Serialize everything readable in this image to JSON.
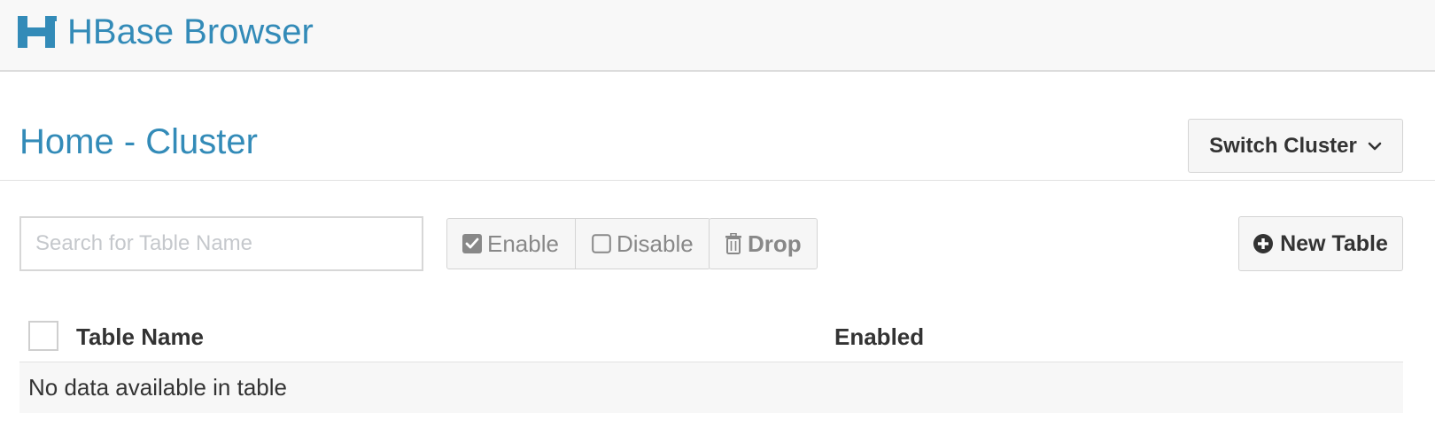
{
  "header": {
    "app_title": "HBase Browser",
    "logo_icon": "hbase-logo-icon",
    "brand_color": "#338bb8"
  },
  "page": {
    "title": "Home - Cluster",
    "switch_cluster_label": "Switch Cluster",
    "switch_cluster_icon": "chevron-down-icon"
  },
  "toolbar": {
    "search_placeholder": "Search for Table Name",
    "search_value": "",
    "enable_label": "Enable",
    "enable_icon": "checked-square-icon",
    "disable_label": "Disable",
    "disable_icon": "empty-square-icon",
    "drop_label": "Drop",
    "drop_icon": "trash-icon",
    "new_table_label": "New Table",
    "new_table_icon": "plus-circle-icon"
  },
  "table": {
    "columns": [
      "Table Name",
      "Enabled"
    ],
    "rows": [],
    "empty_message": "No data available in table"
  }
}
